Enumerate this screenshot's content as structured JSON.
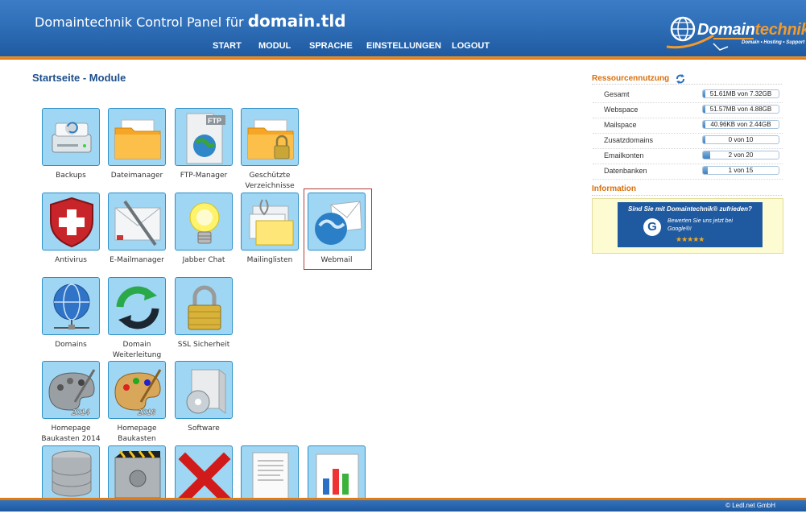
{
  "header": {
    "title_prefix": "Domaintechnik Control Panel für",
    "domain": "domain.tld",
    "nav": [
      "START",
      "MODUL",
      "SPRACHE",
      "EINSTELLUNGEN",
      "LOGOUT"
    ]
  },
  "logo": {
    "brand_a": "Domain",
    "brand_b": "technik",
    "tagline": "Domain • Hosting • Support"
  },
  "page_title": "Startseite - Module",
  "modules": [
    {
      "label": "Backups",
      "icon": "backup-drive-icon"
    },
    {
      "label": "Dateimanager",
      "icon": "folder-icon"
    },
    {
      "label": "FTP-Manager",
      "icon": "ftp-file-icon"
    },
    {
      "label": "Geschützte Verzeichnisse",
      "icon": "locked-folder-icon"
    },
    {
      "label": "Antivirus",
      "icon": "antivirus-shield-icon"
    },
    {
      "label": "E-Mailmanager",
      "icon": "mail-pen-icon"
    },
    {
      "label": "Jabber Chat",
      "icon": "lightbulb-icon"
    },
    {
      "label": "Mailinglisten",
      "icon": "mailing-list-icon"
    },
    {
      "label": "Webmail",
      "icon": "webmail-globe-icon"
    },
    {
      "label": "Domains",
      "icon": "globe-network-icon"
    },
    {
      "label": "Domain Weiterleitung",
      "icon": "redirect-arrows-icon"
    },
    {
      "label": "SSL Sicherheit",
      "icon": "padlock-icon"
    },
    {
      "label": "Homepage Baukasten 2014",
      "icon": "palette-2014-icon"
    },
    {
      "label": "Homepage Baukasten",
      "icon": "palette-2018-icon"
    },
    {
      "label": "Software",
      "icon": "software-box-icon"
    },
    {
      "label": "",
      "icon": "database-icon"
    },
    {
      "label": "",
      "icon": "settings-gears-icon"
    },
    {
      "label": "",
      "icon": "red-x-icon"
    },
    {
      "label": "",
      "icon": "document-icon"
    },
    {
      "label": "",
      "icon": "statistics-chart-icon"
    }
  ],
  "sidebar": {
    "resources_title": "Ressourcennutzung",
    "refresh_icon": "refresh-icon",
    "resources": [
      {
        "label": "Gesamt",
        "value": "51.61MB von 7.32GB",
        "fraction": 0.007
      },
      {
        "label": "Webspace",
        "value": "51.57MB von 4.88GB",
        "fraction": 0.01
      },
      {
        "label": "Mailspace",
        "value": "40.96KB von 2.44GB",
        "fraction": 0.005
      },
      {
        "label": "Zusatzdomains",
        "value": "0 von 10",
        "fraction": 0
      },
      {
        "label": "Emailkonten",
        "value": "2 von 20",
        "fraction": 0.1
      },
      {
        "label": "Datenbanken",
        "value": "1 von 15",
        "fraction": 0.067
      }
    ],
    "information_title": "Information",
    "banner": {
      "headline": "Sind Sie mit Domaintechnik® zufrieden?",
      "text": "Bewerten Sie uns jetzt bei Google®!",
      "stars": "★★★★★",
      "g_letter": "G"
    }
  },
  "footer": {
    "copyright": "© Ledl.net GmbH"
  },
  "colors": {
    "header_blue": "#2f6fb8",
    "accent_orange": "#e27b12",
    "tile_bg": "#9fd6f3",
    "title_blue": "#1d4f8a"
  }
}
